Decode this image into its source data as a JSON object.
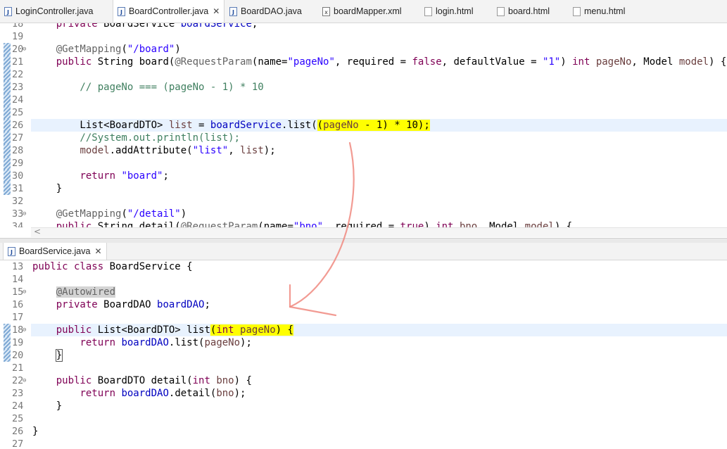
{
  "top_tabs": [
    {
      "label": "LoginController.java",
      "icon": "java-file-icon",
      "glyph": "J"
    },
    {
      "label": "BoardController.java",
      "icon": "java-file-icon",
      "glyph": "J",
      "active": true,
      "close": "✕"
    },
    {
      "label": "BoardDAO.java",
      "icon": "java-file-icon",
      "glyph": "J"
    },
    {
      "label": "boardMapper.xml",
      "icon": "xml-file-icon",
      "glyph": "x"
    },
    {
      "label": "login.html",
      "icon": "html-file-icon",
      "glyph": ""
    },
    {
      "label": "board.html",
      "icon": "html-file-icon",
      "glyph": ""
    },
    {
      "label": "menu.html",
      "icon": "html-file-icon",
      "glyph": ""
    }
  ],
  "top_editor": {
    "lines": [
      {
        "n": "18",
        "code": "    private BoardService boardService;"
      },
      {
        "n": "19",
        "code": ""
      },
      {
        "n": "20",
        "code": "    @GetMapping(\"/board\")"
      },
      {
        "n": "21",
        "code": "    public String board(@RequestParam(name=\"pageNo\", required = false, defaultValue = \"1\") int pageNo, Model model) {"
      },
      {
        "n": "22",
        "code": ""
      },
      {
        "n": "23",
        "code": "        // pageNo === (pageNo - 1) * 10"
      },
      {
        "n": "24",
        "code": ""
      },
      {
        "n": "25",
        "code": ""
      },
      {
        "n": "26",
        "code": "        List<BoardDTO> list = boardService.list((pageNo - 1) * 10);"
      },
      {
        "n": "27",
        "code": "        //System.out.println(list);"
      },
      {
        "n": "28",
        "code": "        model.addAttribute(\"list\", list);"
      },
      {
        "n": "29",
        "code": ""
      },
      {
        "n": "30",
        "code": "        return \"board\";"
      },
      {
        "n": "31",
        "code": "    }"
      },
      {
        "n": "32",
        "code": ""
      },
      {
        "n": "33",
        "code": "    @GetMapping(\"/detail\")"
      },
      {
        "n": "34",
        "code": "    public String detail(@RequestParam(name=\"bno\", required = true) int bno, Model model) {"
      }
    ],
    "scroll_arrow": "<"
  },
  "bottom_tab": {
    "label": "BoardService.java",
    "glyph": "J",
    "close": "✕"
  },
  "bottom_editor": {
    "lines": [
      {
        "n": "13",
        "code": "public class BoardService {"
      },
      {
        "n": "14",
        "code": ""
      },
      {
        "n": "15",
        "code": "    @Autowired"
      },
      {
        "n": "16",
        "code": "    private BoardDAO boardDAO;"
      },
      {
        "n": "17",
        "code": ""
      },
      {
        "n": "18",
        "code": "    public List<BoardDTO> list(int pageNo) {"
      },
      {
        "n": "19",
        "code": "        return boardDAO.list(pageNo);"
      },
      {
        "n": "20",
        "code": "    }"
      },
      {
        "n": "21",
        "code": ""
      },
      {
        "n": "22",
        "code": "    public BoardDTO detail(int bno) {"
      },
      {
        "n": "23",
        "code": "        return boardDAO.detail(bno);"
      },
      {
        "n": "24",
        "code": "    }"
      },
      {
        "n": "25",
        "code": ""
      },
      {
        "n": "26",
        "code": "}"
      },
      {
        "n": "27",
        "code": ""
      }
    ]
  },
  "colors": {
    "keyword": "#7f0055",
    "string": "#2a00ff",
    "field": "#0000c0",
    "comment": "#3f7f5f",
    "highlight": "#ffff00",
    "arrow": "#f08a80"
  }
}
